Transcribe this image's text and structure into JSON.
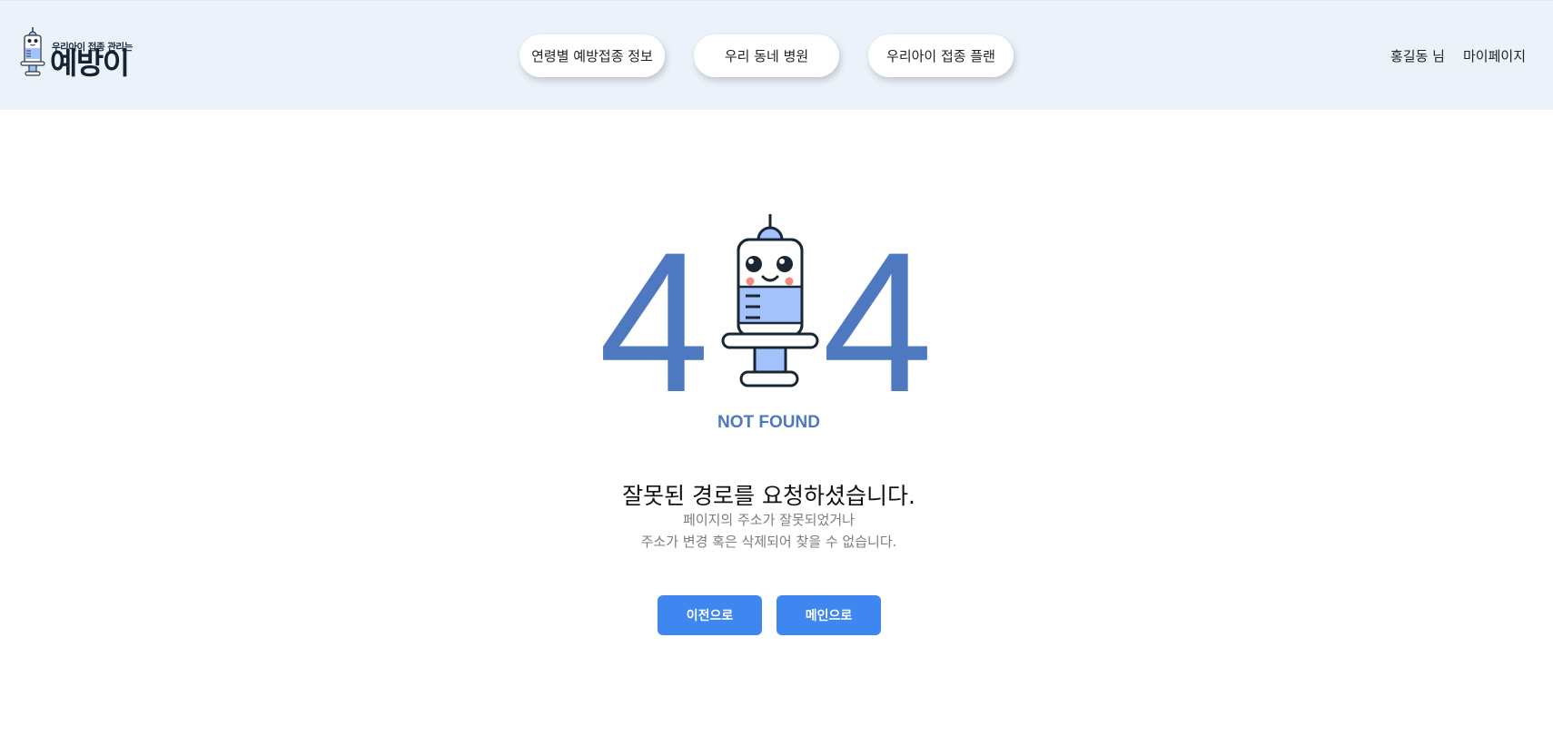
{
  "header": {
    "logo": {
      "subtitle": "우리아이 접종 관리는",
      "name": "예방이"
    },
    "nav": [
      {
        "label": "연령별 예방접종 정보"
      },
      {
        "label": "우리 동네 병원"
      },
      {
        "label": "우리아이 접종 플랜"
      }
    ],
    "user": {
      "name": "홍길동 님",
      "mypage": "마이페이지"
    }
  },
  "error": {
    "code_left": "4",
    "code_right": "4",
    "code_middle_icon": "syringe-mascot-icon",
    "label": "NOT FOUND",
    "title": "잘못된 경로를 요청하셨습니다.",
    "description_line1": "페이지의 주소가 잘못되었거나",
    "description_line2": "주소가 변경 혹은 삭제되어 찾을 수 없습니다."
  },
  "buttons": {
    "back": "이전으로",
    "main": "메인으로"
  },
  "colors": {
    "header_bg": "#ebf2fa",
    "accent_blue": "#4e78bf",
    "button_blue": "#3f86f0",
    "syringe_fill": "#a3c2fb",
    "cheek": "#f38b80"
  }
}
